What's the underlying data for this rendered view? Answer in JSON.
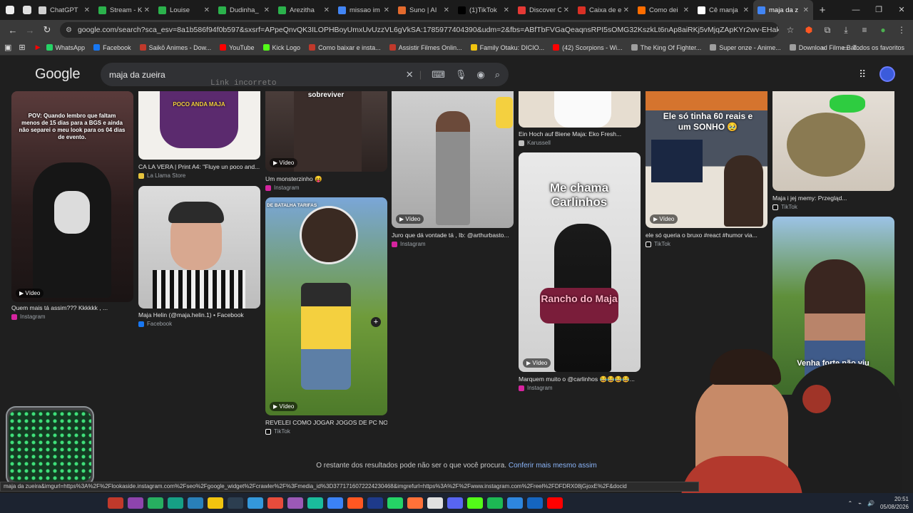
{
  "tabs": [
    {
      "title": "ChatGPT",
      "color": "#d0d0d0"
    },
    {
      "title": "Stream - K",
      "color": "#2bb24c"
    },
    {
      "title": "Louise",
      "color": "#2bb24c"
    },
    {
      "title": "Dudinha_",
      "color": "#2bb24c"
    },
    {
      "title": "Arezitha",
      "color": "#2bb24c"
    },
    {
      "title": "missao im",
      "color": "#4285f4"
    },
    {
      "title": "Suno | AI",
      "color": "#e46a2d"
    },
    {
      "title": "(1)TikTok",
      "color": "#000000"
    },
    {
      "title": "Discover C",
      "color": "#e53935"
    },
    {
      "title": "Caixa de e",
      "color": "#d93025"
    },
    {
      "title": "Como dei",
      "color": "#ff6d00"
    },
    {
      "title": "Cê manja",
      "color": "#ffffff"
    },
    {
      "title": "maja da z",
      "color": "#4285f4"
    }
  ],
  "address": "google.com/search?sca_esv=8a1b586f94f0b597&sxsrf=APpeQnvQK3ILOPHBoyUmxUvUzzVL6gVkSA:1785977404390&udm=2&fbs=ABfTbFVGaQeaqnsRPI5sOMG32KszkLt6nAp8aiRKj5vMjqZApKYr2wv-EHakX1SS4JF8fY1JwuC_ZyBFsIRqbm...",
  "bookmarks": [
    {
      "label": "WhatsApp",
      "color": "#25d366"
    },
    {
      "label": "Facebook",
      "color": "#1877f2"
    },
    {
      "label": "Saikō Animes - Dow...",
      "color": "#c0392b"
    },
    {
      "label": "YouTube",
      "color": "#ff0000"
    },
    {
      "label": "Kick Logo",
      "color": "#53fc18"
    },
    {
      "label": "Como baixar e insta...",
      "color": "#c0392b"
    },
    {
      "label": "Assistir Filmes Onlin...",
      "color": "#c0392b"
    },
    {
      "label": "Family Otaku: DICIO...",
      "color": "#f1c40f"
    },
    {
      "label": "(42) Scorpions - Wi...",
      "color": "#ff0000"
    },
    {
      "label": "The King Of Fighter...",
      "color": "#9e9e9e"
    },
    {
      "label": "Super onze - Anime...",
      "color": "#9e9e9e"
    },
    {
      "label": "Download Filme Bat...",
      "color": "#9e9e9e"
    }
  ],
  "bookmarks_more": "»",
  "bookmarks_all": "Todos os favoritos",
  "google_logo": "Google",
  "search_query": "maja da zueira",
  "ghost_text": "Link incorreto",
  "results": [
    {
      "caption": "",
      "source": "",
      "overlay": "POCO ANDA MAJA",
      "video": false
    },
    {
      "caption": "CA LA VERA | Print A4: \"Fluye un poco and...",
      "source": "La Llama Store",
      "video": false
    },
    {
      "caption": "Maja Helin (@maja.helin.1) • Facebook",
      "source": "Facebook",
      "video": false
    },
    {
      "caption": "Quem mais tá assim??? Kkkkkk , ...",
      "source": "Instagram",
      "overlay": "POV: Quando lembro que faltam menos de 15 dias para a BGS e ainda não separei o meu look para os 04 dias de evento.",
      "video": true
    },
    {
      "caption": "Um monsterzinho 😝",
      "source": "Instagram",
      "overlay": "sobreviver",
      "video": true
    },
    {
      "caption": "REVELEI COMO JOGAR JOGOS DE PC NO...",
      "source": "TikTok",
      "overlay": "DE BATALHA   TARIFAS",
      "video": true
    },
    {
      "caption": "Juro que dá vontade tá , Ib: @arthurbasto...",
      "source": "Instagram",
      "video": true
    },
    {
      "caption": "Ein Hoch auf Biene Maja: Eko Fresh...",
      "source": "Karussell",
      "video": false
    },
    {
      "caption": "Marquem muito o @carlinhos 😂😂😂😂...",
      "source": "Instagram",
      "overlay": "Me chama Carlinhos",
      "overlay2": "Rancho do Maja",
      "video": true
    },
    {
      "caption": "ele só queria o bruxo #react #humor via...",
      "source": "TikTok",
      "overlay": "Ele só tinha 60 reais e um SONHO 🥹",
      "video": true
    },
    {
      "caption": "Maja i jej memy: Przegląd...",
      "source": "TikTok",
      "video": false
    },
    {
      "caption": "",
      "source": "",
      "overlay": "Venha forte não viu",
      "video": false
    }
  ],
  "video_label": "Vídeo",
  "footer_text": "O restante dos resultados pode não ser o que você procura.",
  "footer_link": "Conferir mais mesmo assim",
  "status_url": "maja da zueira&imgurl=https%3A%2F%2Flookaside.instagram.com%2Fseo%2Fgoogle_widget%2Fcrawler%2F%3Fmedia_id%3D3771716072224230468&imgrefurl=https%3A%2F%2Fwww.instagram.com%2Freel%2FDFDRX08jGjoxE%2F&docid",
  "clock_time": "20:51",
  "clock_date": "05/08/2026"
}
